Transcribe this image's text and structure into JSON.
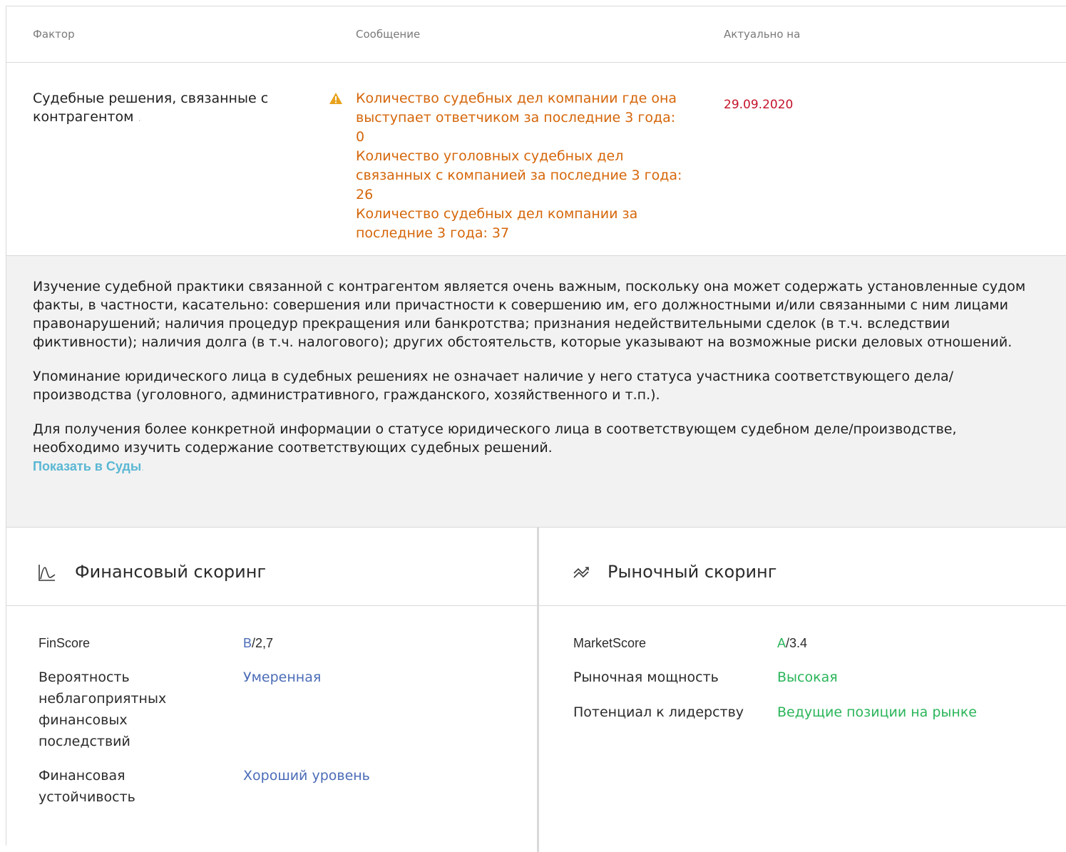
{
  "table": {
    "headers": {
      "factor": "Фактор",
      "message": "Сообщение",
      "date": "Актуально на"
    },
    "row": {
      "factor": "Судебные решения, связанные с контрагентом",
      "factor_marker": ".",
      "messages": [
        "Количество судебных дел компании где она выступает ответчиком за последние 3 года: 0",
        "Количество уголовных судебных дел связанных с компанией за последние 3 года: 26",
        "Количество судебных дел компании за последние 3 года: 37"
      ],
      "date": "29.09.2020",
      "icon": "warning-icon",
      "warning_color": "#e8a21c",
      "message_color": "#d5660a",
      "date_color": "#c4132a"
    }
  },
  "description": {
    "paragraphs": [
      "Изучение судебной практики связанной с контрагентом является очень важным, поскольку она может содержать установленные судом факты, в частности, касательно: совершения или причастности к совершению им, его должностными и/или связанными с ним лицами правонарушений; наличия процедур прекращения или банкротства; признания недействительными сделок (в т.ч. вследствии фиктивности); наличия долга (в т.ч. налогового); других обстоятельств, которые указывают на возможные риски деловых отношений.",
      "Упоминание юридического лица в судебных решениях не означает наличие у него статуса участника соответствующего дела/производства (уголовного, административного, гражданского, хозяйственного и т.п.).",
      "Для получения более конкретной информации о статусе юридического лица в соответствующем судебном деле/производстве, необходимо изучить содержание соответствующих судебных решений."
    ],
    "link_label": "Показать в Суды",
    "link_marker": "."
  },
  "financial": {
    "title": "Финансовый скоринг",
    "icon": "financial-chart-icon",
    "rows": [
      {
        "label": "FinScore",
        "grade": "B",
        "score": "/2,7"
      },
      {
        "label": "Вероятность неблагоприятных финансовых последствий",
        "value": "Умеренная"
      },
      {
        "label": "Финансовая устойчивость",
        "value": "Хороший уровень"
      }
    ]
  },
  "market": {
    "title": "Рыночный скоринг",
    "icon": "market-trend-icon",
    "rows": [
      {
        "label": "MarketScore",
        "grade": "A",
        "score": "/3.4"
      },
      {
        "label": "Рыночная мощность",
        "value": "Высокая"
      },
      {
        "label": "Потенциал к лидерству",
        "value": "Ведущие позиции на рынке"
      }
    ]
  },
  "colors": {
    "blue": "#4b6cb7",
    "green": "#2bb55a",
    "link": "#5ab7d3",
    "panel_background": "#f2f2f2",
    "border": "#d9d9d9"
  }
}
